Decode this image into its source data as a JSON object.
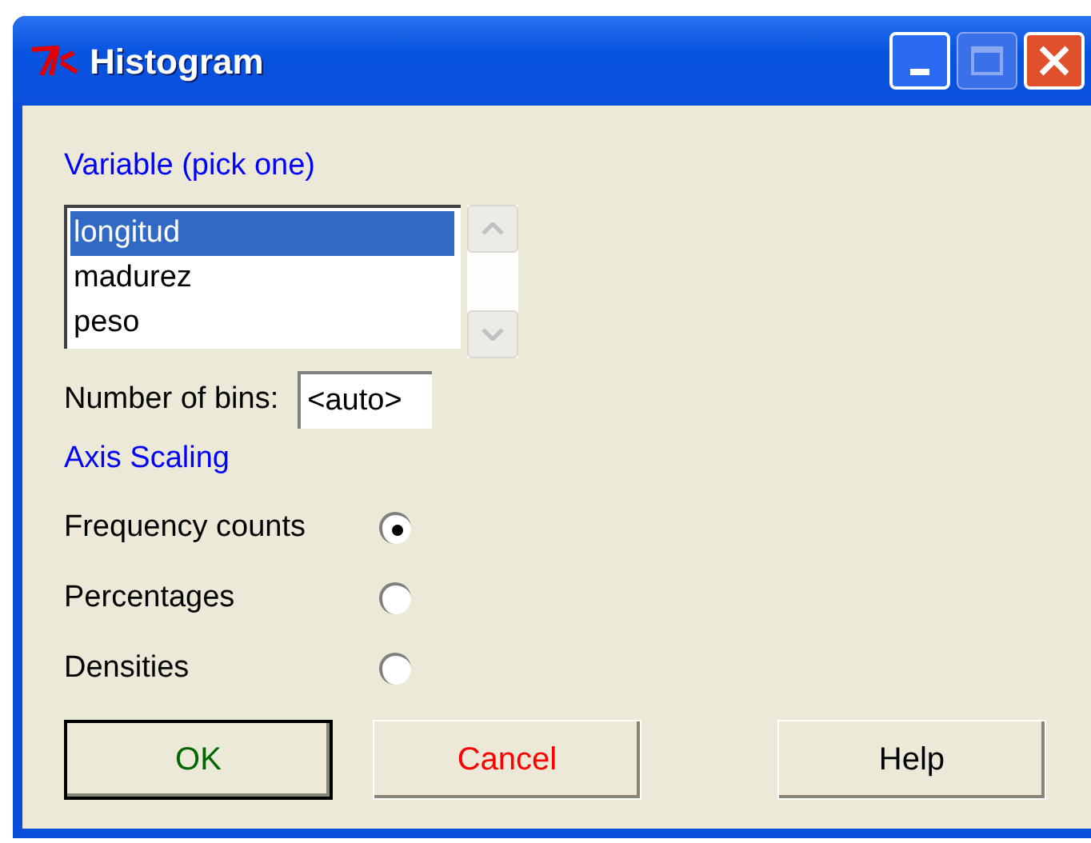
{
  "window": {
    "title": "Histogram"
  },
  "variable": {
    "label": "Variable (pick one)",
    "items": [
      {
        "label": "longitud",
        "selected": true
      },
      {
        "label": "madurez",
        "selected": false
      },
      {
        "label": "peso",
        "selected": false
      }
    ]
  },
  "bins": {
    "label": "Number of bins:",
    "value": "<auto>"
  },
  "axis_scaling": {
    "label": "Axis Scaling",
    "options": [
      {
        "label": "Frequency counts",
        "selected": true
      },
      {
        "label": "Percentages",
        "selected": false
      },
      {
        "label": "Densities",
        "selected": false
      }
    ]
  },
  "buttons": [
    {
      "label": "OK",
      "color": "#006600",
      "default": true
    },
    {
      "label": "Cancel",
      "color": "#ff0000",
      "default": false
    },
    {
      "label": "Help",
      "color": "#000000",
      "default": false
    }
  ]
}
